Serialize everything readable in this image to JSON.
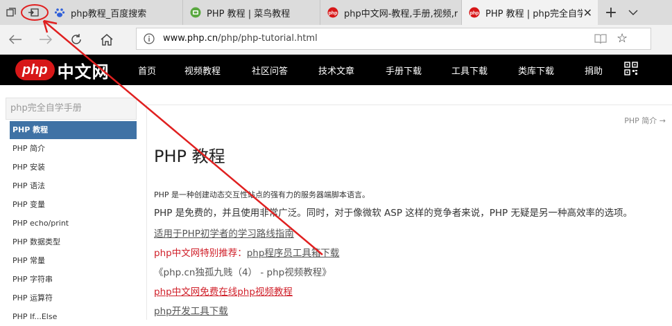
{
  "browser": {
    "tabs": [
      {
        "title": "php教程_百度搜索",
        "favicon": "baidu-paw-icon",
        "active": false
      },
      {
        "title": "PHP 教程 | 菜鸟教程",
        "favicon": "runoob-icon",
        "active": false
      },
      {
        "title": "php中文网-教程,手册,视频,r",
        "favicon": "php-cn-icon",
        "active": false
      },
      {
        "title": "PHP 教程 | php完全自学",
        "favicon": "php-cn-icon",
        "active": true
      }
    ],
    "address": {
      "domain": "www.php.cn",
      "path": "/php/php-tutorial.html"
    }
  },
  "site": {
    "logo_mark": "php",
    "logo_text": "中文网",
    "nav": [
      "首页",
      "视频教程",
      "社区问答",
      "技术文章",
      "手册下载",
      "工具下载",
      "类库下载",
      "捐助"
    ]
  },
  "sidebar": {
    "title": "php完全自学手册",
    "items": [
      "PHP 教程",
      "PHP 简介",
      "PHP 安装",
      "PHP 语法",
      "PHP 变量",
      "PHP echo/print",
      "PHP 数据类型",
      "PHP 常量",
      "PHP 字符串",
      "PHP 运算符",
      "PHP If...Else"
    ],
    "active_index": 0
  },
  "main": {
    "next_link": "PHP 简介 →",
    "heading": "PHP 教程",
    "intro_small": "PHP 是一种创建动态交互性站点的强有力的服务器端脚本语言。",
    "intro_big": "PHP 是免费的，并且使用非常广泛。同时，对于像微软 ASP 这样的竞争者来说，PHP 无疑是另一种高效率的选项。",
    "link1": "适用于PHP初学者的学习路线指南",
    "special_label": "php中文网特别推荐：",
    "special_link": "php程序员工具箱下载",
    "link3": "《php.cn独孤九贱（4） - php视频教程》",
    "link4": "php中文网免费在线php视频教程",
    "link5": "php开发工具下载"
  },
  "colors": {
    "accent_red": "#d0202a",
    "sidebar_active": "#3f72a5",
    "nav_bg": "#000000"
  }
}
